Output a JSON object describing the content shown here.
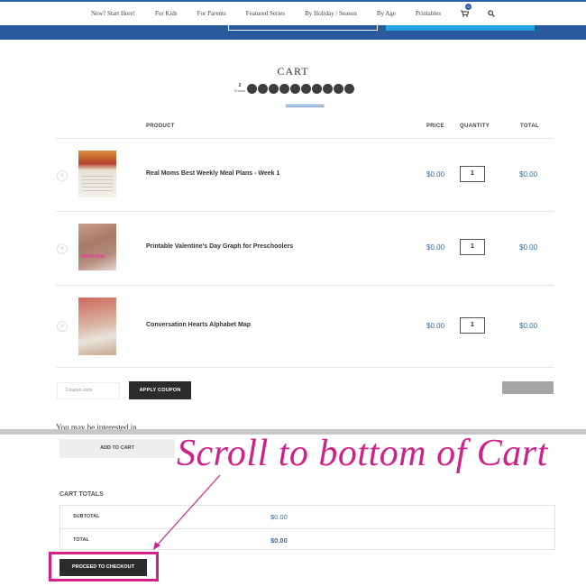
{
  "nav": {
    "items": [
      "New? Start Here!",
      "For Kids",
      "For Parents",
      "Featured Series",
      "By Holiday / Season",
      "By Age",
      "Printables"
    ],
    "cart_count": "0"
  },
  "cart": {
    "title": "CART",
    "share_count": "2",
    "share_label": "Shares",
    "share_icons": [
      "pinterest-icon",
      "facebook-icon",
      "twitter-icon",
      "google-plus-icon",
      "twitter-bird-icon",
      "stumbleupon-icon",
      "yummly-icon",
      "flipboard-icon",
      "email-icon",
      "more-icon"
    ]
  },
  "table": {
    "headers": {
      "product": "PRODUCT",
      "price": "PRICE",
      "quantity": "QUANTITY",
      "total": "TOTAL"
    },
    "rows": [
      {
        "name": "Real Moms Best Weekly Meal Plans - Week 1",
        "price": "$0.00",
        "qty": "1",
        "total": "$0.00"
      },
      {
        "name": "Printable Valentine's Day Graph for Preschoolers",
        "price": "$0.00",
        "qty": "1",
        "total": "$0.00"
      },
      {
        "name": "Conversation Hearts Alphabet Map",
        "price": "$0.00",
        "qty": "1",
        "total": "$0.00"
      }
    ],
    "remove_glyph": "×"
  },
  "coupon": {
    "placeholder": "Coupon code",
    "apply_label": "APPLY COUPON"
  },
  "lower": {
    "partial_heading": "You may be interested in…",
    "add_to_cart_label": "ADD TO CART",
    "annotation": "Scroll to bottom of Cart",
    "totals_title": "CART TOTALS",
    "subtotal_label": "SUBTOTAL",
    "subtotal_value": "$0.00",
    "total_label": "TOTAL",
    "total_value": "$0.00",
    "checkout_label": "PROCEED TO CHECKOUT"
  },
  "colors": {
    "brand_blue": "#2b5a9c",
    "price_blue": "#2e68ad",
    "annotation_pink": "#d0208a",
    "button_dark": "#2b2b2b"
  }
}
